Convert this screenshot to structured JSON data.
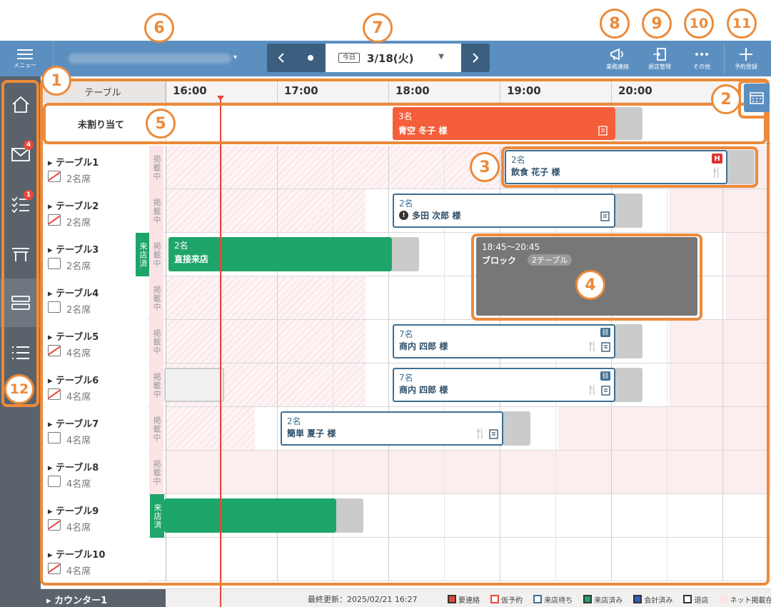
{
  "header": {
    "menu_label": "メニュー",
    "today_label": "今日",
    "date": "3/18(火)",
    "buttons": {
      "contact": "業務連絡",
      "exit": "退店管理",
      "more": "その他",
      "add": "予約登録"
    }
  },
  "sidebar": {
    "mail_badge": "4",
    "tasks_badge": "1"
  },
  "grid": {
    "column_header": "テーブル",
    "hours": [
      "16:00",
      "17:00",
      "18:00",
      "19:00",
      "20:00"
    ],
    "unassigned": {
      "label": "未割り当て",
      "reservation": {
        "count": "3名",
        "name": "青空 冬子 様"
      }
    },
    "published_label": "掲載中",
    "arrived_label": "来店済",
    "tables": [
      {
        "name": "テーブル1",
        "seats": "2名席"
      },
      {
        "name": "テーブル2",
        "seats": "2名席"
      },
      {
        "name": "テーブル3",
        "seats": "2名席"
      },
      {
        "name": "テーブル4",
        "seats": "2名席"
      },
      {
        "name": "テーブル5",
        "seats": "4名席"
      },
      {
        "name": "テーブル6",
        "seats": "4名席"
      },
      {
        "name": "テーブル7",
        "seats": "4名席"
      },
      {
        "name": "テーブル8",
        "seats": "4名席"
      },
      {
        "name": "テーブル9",
        "seats": "4名席"
      },
      {
        "name": "テーブル10",
        "seats": "4名席"
      }
    ],
    "counter": "カウンター1",
    "reservations": {
      "t1": {
        "count": "2名",
        "name": "飲食 花子 様",
        "badge": "H"
      },
      "t2": {
        "count": "2名",
        "name": "多田 次郎 様"
      },
      "t3": {
        "count": "2名",
        "name": "直接来店"
      },
      "block": {
        "time": "18:45～20:45",
        "label": "ブロック",
        "tag": "2テーブル"
      },
      "t5": {
        "count": "7名",
        "name": "商内 四郎 様"
      },
      "t6": {
        "count": "7名",
        "name": "商内 四郎 様"
      },
      "t7": {
        "count": "2名",
        "name": "簡単 夏子 様"
      }
    }
  },
  "footer": {
    "last_updated": "最終更新：2025/02/21 16:27",
    "legend": [
      {
        "label": "要連絡",
        "color": "#e8463a"
      },
      {
        "label": "仮予約",
        "color": "#f07a5a"
      },
      {
        "label": "来店待ち",
        "color": "#3d6f93"
      },
      {
        "label": "来店済み",
        "color": "#1ea56a"
      },
      {
        "label": "会計済み",
        "color": "#2f5fc4"
      },
      {
        "label": "退店",
        "color": "#333333"
      },
      {
        "label": "ネット掲載在庫",
        "color": "#fbe3e6"
      }
    ]
  },
  "callouts": [
    "1",
    "2",
    "3",
    "4",
    "5",
    "6",
    "7",
    "8",
    "9",
    "10",
    "11",
    "12"
  ]
}
